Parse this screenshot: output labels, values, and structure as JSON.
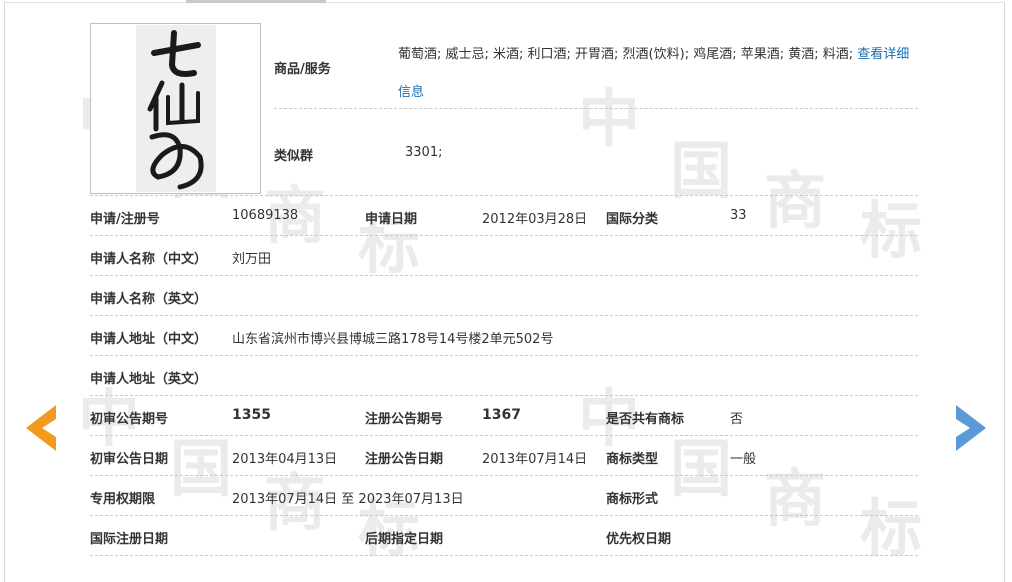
{
  "watermark": {
    "chars": [
      "中",
      "国",
      "商",
      "标"
    ]
  },
  "trademark": {
    "image_text": "七仙女",
    "goods_label": "商品/服务",
    "goods_text": "葡萄酒; 威士忌; 米酒; 利口酒; 开胃酒; 烈酒(饮料); 鸡尾酒; 苹果酒; 黄酒; 料酒;",
    "goods_link": "查看详细信息",
    "similar_group_label": "类似群",
    "similar_group_value": "3301;"
  },
  "fields": {
    "reg_no_label": "申请/注册号",
    "reg_no_value": "10689138",
    "apply_date_label": "申请日期",
    "apply_date_value": "2012年03月28日",
    "intl_class_label": "国际分类",
    "intl_class_value": "33",
    "applicant_cn_label": "申请人名称（中文）",
    "applicant_cn_value": "刘万田",
    "applicant_en_label": "申请人名称（英文）",
    "applicant_en_value": "",
    "address_cn_label": "申请人地址（中文）",
    "address_cn_value": "山东省滨州市博兴县博城三路178号14号楼2单元502号",
    "address_en_label": "申请人地址（英文）",
    "address_en_value": "",
    "prelim_issue_label": "初审公告期号",
    "prelim_issue_value": "1355",
    "reg_issue_label": "注册公告期号",
    "reg_issue_value": "1367",
    "shared_label": "是否共有商标",
    "shared_value": "否",
    "prelim_date_label": "初审公告日期",
    "prelim_date_value": "2013年04月13日",
    "reg_date_label": "注册公告日期",
    "reg_date_value": "2013年07月14日",
    "type_label": "商标类型",
    "type_value": "一般",
    "exclusive_label": "专用权期限",
    "exclusive_value": "2013年07月14日 至 2023年07月13日",
    "form_label": "商标形式",
    "form_value": "",
    "intl_reg_date_label": "国际注册日期",
    "intl_reg_date_value": "",
    "later_date_label": "后期指定日期",
    "later_date_value": "",
    "priority_date_label": "优先权日期",
    "priority_date_value": ""
  },
  "nav": {
    "prev_color": "#f39a1e",
    "next_color": "#5b9bd5",
    "prev_icon": "arrow-left-icon",
    "next_icon": "arrow-right-icon"
  }
}
